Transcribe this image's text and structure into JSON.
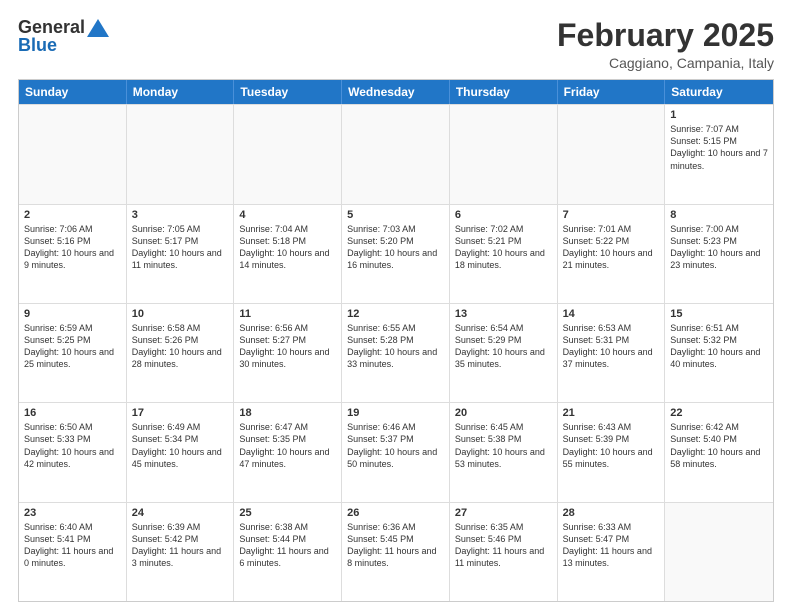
{
  "logo": {
    "general": "General",
    "blue": "Blue"
  },
  "header": {
    "month_title": "February 2025",
    "location": "Caggiano, Campania, Italy"
  },
  "weekdays": [
    "Sunday",
    "Monday",
    "Tuesday",
    "Wednesday",
    "Thursday",
    "Friday",
    "Saturday"
  ],
  "rows": [
    [
      {
        "day": "",
        "info": ""
      },
      {
        "day": "",
        "info": ""
      },
      {
        "day": "",
        "info": ""
      },
      {
        "day": "",
        "info": ""
      },
      {
        "day": "",
        "info": ""
      },
      {
        "day": "",
        "info": ""
      },
      {
        "day": "1",
        "info": "Sunrise: 7:07 AM\nSunset: 5:15 PM\nDaylight: 10 hours and 7 minutes."
      }
    ],
    [
      {
        "day": "2",
        "info": "Sunrise: 7:06 AM\nSunset: 5:16 PM\nDaylight: 10 hours and 9 minutes."
      },
      {
        "day": "3",
        "info": "Sunrise: 7:05 AM\nSunset: 5:17 PM\nDaylight: 10 hours and 11 minutes."
      },
      {
        "day": "4",
        "info": "Sunrise: 7:04 AM\nSunset: 5:18 PM\nDaylight: 10 hours and 14 minutes."
      },
      {
        "day": "5",
        "info": "Sunrise: 7:03 AM\nSunset: 5:20 PM\nDaylight: 10 hours and 16 minutes."
      },
      {
        "day": "6",
        "info": "Sunrise: 7:02 AM\nSunset: 5:21 PM\nDaylight: 10 hours and 18 minutes."
      },
      {
        "day": "7",
        "info": "Sunrise: 7:01 AM\nSunset: 5:22 PM\nDaylight: 10 hours and 21 minutes."
      },
      {
        "day": "8",
        "info": "Sunrise: 7:00 AM\nSunset: 5:23 PM\nDaylight: 10 hours and 23 minutes."
      }
    ],
    [
      {
        "day": "9",
        "info": "Sunrise: 6:59 AM\nSunset: 5:25 PM\nDaylight: 10 hours and 25 minutes."
      },
      {
        "day": "10",
        "info": "Sunrise: 6:58 AM\nSunset: 5:26 PM\nDaylight: 10 hours and 28 minutes."
      },
      {
        "day": "11",
        "info": "Sunrise: 6:56 AM\nSunset: 5:27 PM\nDaylight: 10 hours and 30 minutes."
      },
      {
        "day": "12",
        "info": "Sunrise: 6:55 AM\nSunset: 5:28 PM\nDaylight: 10 hours and 33 minutes."
      },
      {
        "day": "13",
        "info": "Sunrise: 6:54 AM\nSunset: 5:29 PM\nDaylight: 10 hours and 35 minutes."
      },
      {
        "day": "14",
        "info": "Sunrise: 6:53 AM\nSunset: 5:31 PM\nDaylight: 10 hours and 37 minutes."
      },
      {
        "day": "15",
        "info": "Sunrise: 6:51 AM\nSunset: 5:32 PM\nDaylight: 10 hours and 40 minutes."
      }
    ],
    [
      {
        "day": "16",
        "info": "Sunrise: 6:50 AM\nSunset: 5:33 PM\nDaylight: 10 hours and 42 minutes."
      },
      {
        "day": "17",
        "info": "Sunrise: 6:49 AM\nSunset: 5:34 PM\nDaylight: 10 hours and 45 minutes."
      },
      {
        "day": "18",
        "info": "Sunrise: 6:47 AM\nSunset: 5:35 PM\nDaylight: 10 hours and 47 minutes."
      },
      {
        "day": "19",
        "info": "Sunrise: 6:46 AM\nSunset: 5:37 PM\nDaylight: 10 hours and 50 minutes."
      },
      {
        "day": "20",
        "info": "Sunrise: 6:45 AM\nSunset: 5:38 PM\nDaylight: 10 hours and 53 minutes."
      },
      {
        "day": "21",
        "info": "Sunrise: 6:43 AM\nSunset: 5:39 PM\nDaylight: 10 hours and 55 minutes."
      },
      {
        "day": "22",
        "info": "Sunrise: 6:42 AM\nSunset: 5:40 PM\nDaylight: 10 hours and 58 minutes."
      }
    ],
    [
      {
        "day": "23",
        "info": "Sunrise: 6:40 AM\nSunset: 5:41 PM\nDaylight: 11 hours and 0 minutes."
      },
      {
        "day": "24",
        "info": "Sunrise: 6:39 AM\nSunset: 5:42 PM\nDaylight: 11 hours and 3 minutes."
      },
      {
        "day": "25",
        "info": "Sunrise: 6:38 AM\nSunset: 5:44 PM\nDaylight: 11 hours and 6 minutes."
      },
      {
        "day": "26",
        "info": "Sunrise: 6:36 AM\nSunset: 5:45 PM\nDaylight: 11 hours and 8 minutes."
      },
      {
        "day": "27",
        "info": "Sunrise: 6:35 AM\nSunset: 5:46 PM\nDaylight: 11 hours and 11 minutes."
      },
      {
        "day": "28",
        "info": "Sunrise: 6:33 AM\nSunset: 5:47 PM\nDaylight: 11 hours and 13 minutes."
      },
      {
        "day": "",
        "info": ""
      }
    ]
  ]
}
